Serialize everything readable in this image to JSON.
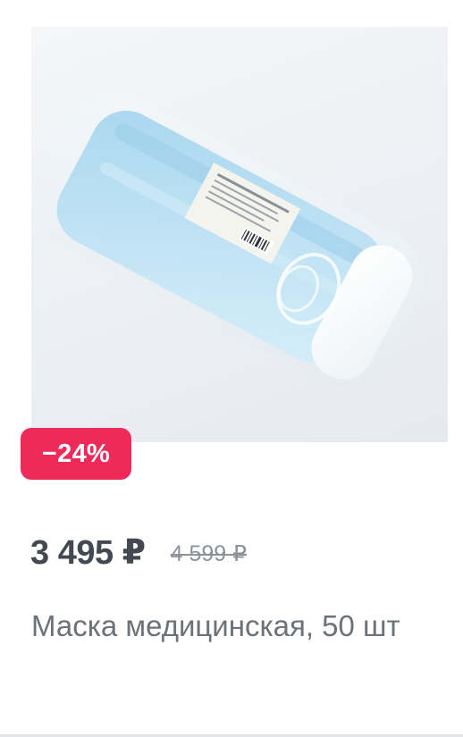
{
  "product": {
    "discount_badge": "−24%",
    "price_current": "3 495 ₽",
    "price_old": "4 599 ₽",
    "title": "Маска медицинская, 50 шт"
  },
  "colors": {
    "badge_background": "#ee2a5a",
    "price_text": "#424950",
    "old_price_text": "#8c9399",
    "title_text": "#6b7278"
  }
}
